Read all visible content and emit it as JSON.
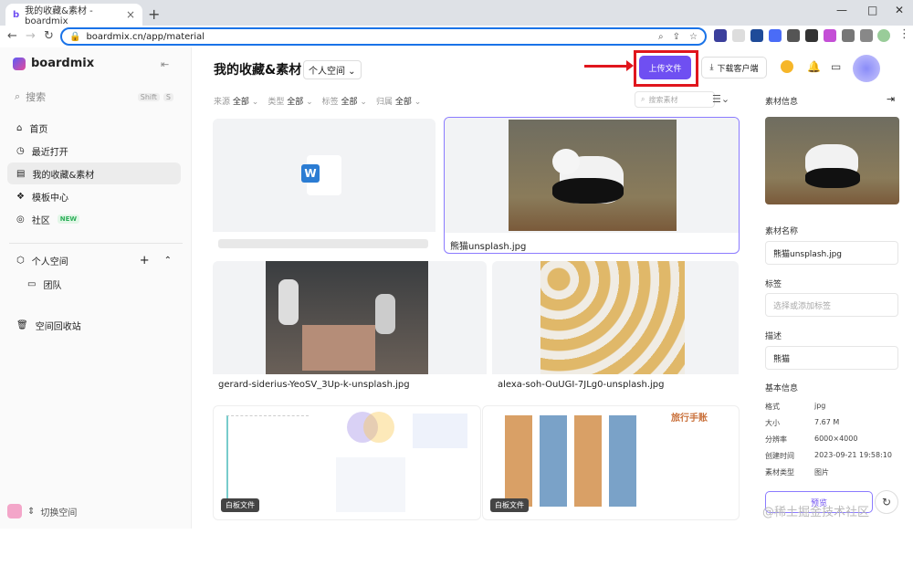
{
  "browser": {
    "tab_title": "我的收藏&素材 - boardmix",
    "url": "boardmix.cn/app/material"
  },
  "sidebar": {
    "brand": "boardmix",
    "search_label": "搜索",
    "search_keys": [
      "Shift",
      "S"
    ],
    "items": [
      {
        "label": "首页",
        "icon": "home-icon"
      },
      {
        "label": "最近打开",
        "icon": "clock-icon"
      },
      {
        "label": "我的收藏&素材",
        "icon": "collection-icon"
      },
      {
        "label": "模板中心",
        "icon": "template-icon"
      },
      {
        "label": "社区",
        "icon": "community-icon",
        "badge": "NEW"
      }
    ],
    "personal_space": "个人空间",
    "team": "团队",
    "recycle": "空间回收站",
    "switch_space": "切换空间"
  },
  "main": {
    "title": "我的收藏&素材",
    "space_select": "个人空间",
    "filters": [
      {
        "label": "来源",
        "value": "全部"
      },
      {
        "label": "类型",
        "value": "全部"
      },
      {
        "label": "标签",
        "value": "全部"
      },
      {
        "label": "归属",
        "value": "全部"
      }
    ],
    "search_placeholder": "搜索素材",
    "cards": [
      {
        "caption": "",
        "kind": "word"
      },
      {
        "caption": "熊猫unsplash.jpg",
        "kind": "image"
      },
      {
        "caption": "gerard-siderius-YeoSV_3Up-k-unsplash.jpg",
        "kind": "image"
      },
      {
        "caption": "alexa-soh-OuUGI-7JLg0-unsplash.jpg",
        "kind": "image"
      },
      {
        "caption": "",
        "kind": "whiteboard",
        "tag": "白板文件"
      },
      {
        "caption": "",
        "kind": "whiteboard",
        "tag": "白板文件",
        "heading": "旅行手账"
      }
    ]
  },
  "header": {
    "upload_label": "上传文件",
    "download_label": "下载客户端"
  },
  "panel": {
    "title": "素材信息",
    "name_label": "素材名称",
    "name_value": "熊猫unsplash.jpg",
    "tag_label": "标签",
    "tag_placeholder": "选择或添加标签",
    "desc_label": "描述",
    "desc_value": "熊猫",
    "basic_label": "基本信息",
    "meta": [
      {
        "k": "格式",
        "v": "jpg"
      },
      {
        "k": "大小",
        "v": "7.67 M"
      },
      {
        "k": "分辨率",
        "v": "6000×4000"
      },
      {
        "k": "创建时间",
        "v": "2023-09-21 19:58:10"
      },
      {
        "k": "素材类型",
        "v": "图片"
      }
    ],
    "preview_label": "预览"
  },
  "watermark": "@稀土掘金技术社区"
}
